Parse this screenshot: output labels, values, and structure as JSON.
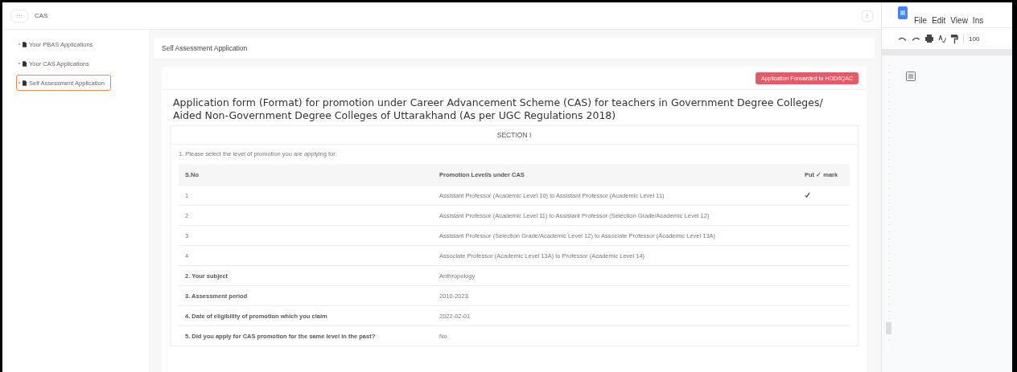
{
  "topbar": {
    "menu_button": "···",
    "title": "CAS",
    "action_button": "⁝"
  },
  "sidebar": {
    "items": [
      {
        "label": "Your PBAS Applications",
        "selected": false
      },
      {
        "label": "Your CAS Applications",
        "selected": false
      },
      {
        "label": "Self Assessment Application",
        "selected": true
      }
    ]
  },
  "panel": {
    "title": "Self Assessment Application",
    "status_badge": "Application Forwarded to HOD/IQAC",
    "form_title": "Application form (Format) for promotion under Career Advancement Scheme (CAS) for teachers in Government Degree Colleges/ Aided Non-Government Degree Colleges of Uttarakhand (As per UGC Regulations 2018)",
    "section": "SECTION I",
    "question": "1. Please select the level of promotion you are applying for:",
    "table": {
      "columns": [
        "S.No",
        "Promotion Level/s under CAS",
        "Put ✓ mark"
      ],
      "rows": [
        {
          "kind": "level",
          "no": "1",
          "text": "Assistant Professor (Academic Level 10) to Assistant Professor (Academic Level 11)",
          "checked": true
        },
        {
          "kind": "level",
          "no": "2",
          "text": "Assistant Professor (Academic Level 11) to Assistant Professor (Selection Grade/Academic Level 12)",
          "checked": false
        },
        {
          "kind": "level",
          "no": "3",
          "text": "Assistant Professor (Selection Grade/Academic Level 12) to Associate Professor (Academic Level 13A)",
          "checked": false
        },
        {
          "kind": "level",
          "no": "4",
          "text": "Associate Professor (Academic Level 13A) to Professor (Academic Level 14)",
          "checked": false
        },
        {
          "kind": "question",
          "label": "2. Your subject",
          "value": "Anthropology"
        },
        {
          "kind": "question",
          "label": "3. Assessment period",
          "value": "2010-2023"
        },
        {
          "kind": "question",
          "label": "4. Date of eligibility of promotion which you claim",
          "value": "2022-02-01"
        },
        {
          "kind": "question",
          "label": "5. Did you apply for CAS promotion for the same level in the past?",
          "value": "No"
        }
      ]
    }
  },
  "docs": {
    "menu": [
      "File",
      "Edit",
      "View",
      "Ins"
    ],
    "zoom": "100"
  }
}
